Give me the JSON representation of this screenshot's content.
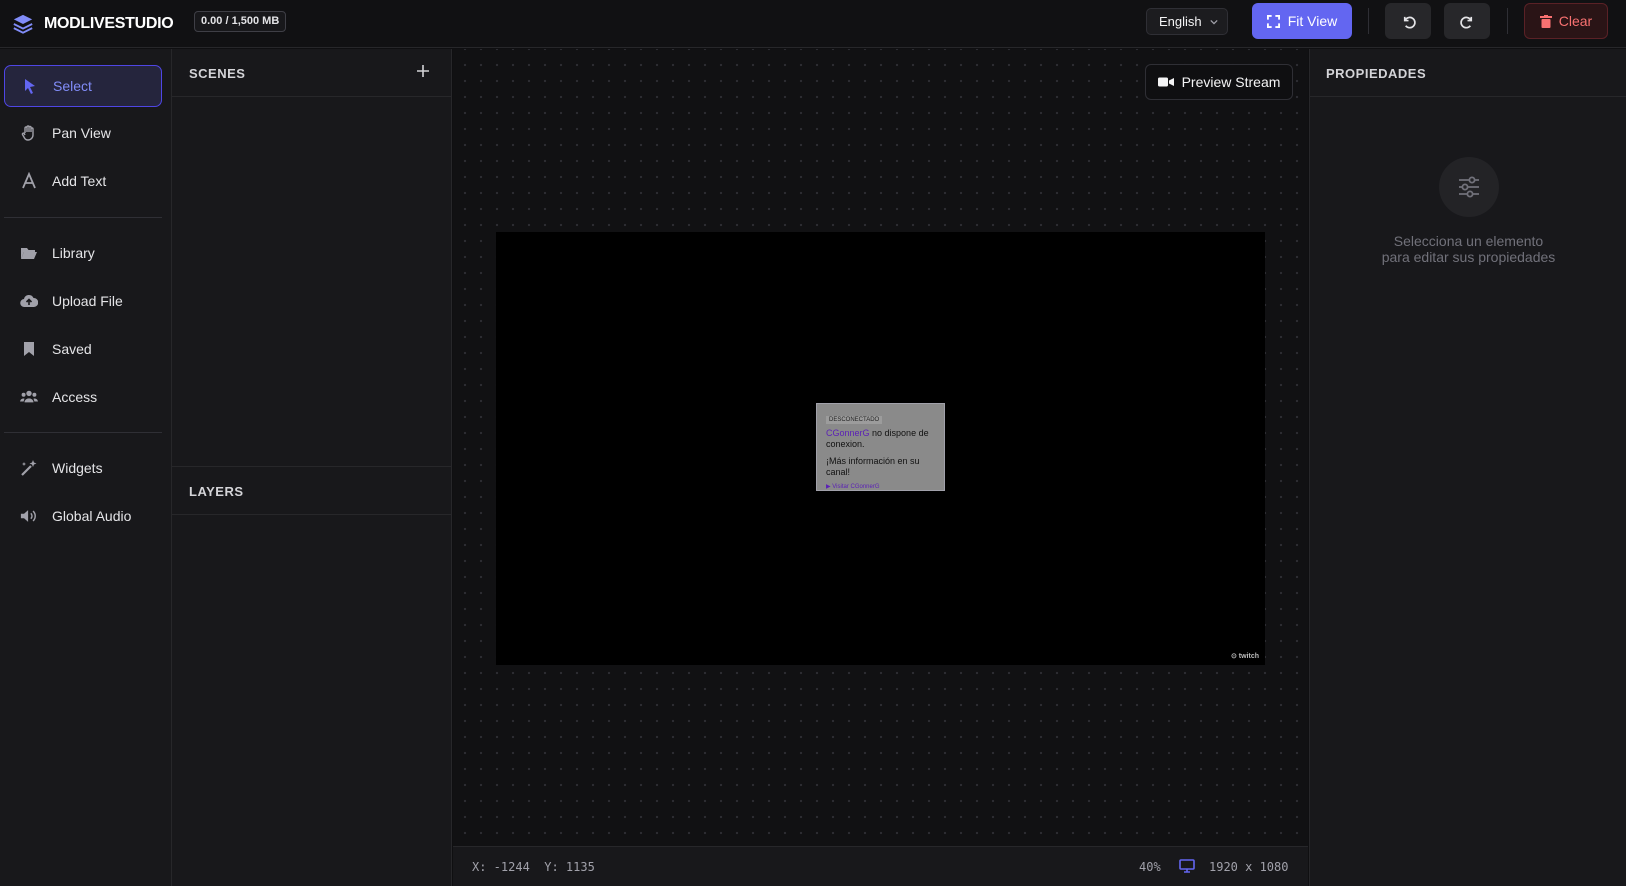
{
  "app": {
    "title": "MODLIVESTUDIO",
    "storage": "0.00 / 1,500 MB"
  },
  "header": {
    "language": "English",
    "fit_view_label": "Fit View",
    "clear_label": "Clear",
    "undo_icon": "undo-icon",
    "redo_icon": "redo-icon"
  },
  "tools": [
    {
      "label": "Select",
      "icon": "cursor-icon",
      "active": true
    },
    {
      "label": "Pan View",
      "icon": "hand-icon"
    },
    {
      "label": "Add Text",
      "icon": "text-icon"
    },
    {
      "label": "Library",
      "icon": "folder-icon"
    },
    {
      "label": "Upload File",
      "icon": "cloud-upload-icon"
    },
    {
      "label": "Saved",
      "icon": "bookmark-icon"
    },
    {
      "label": "Access",
      "icon": "users-icon"
    },
    {
      "label": "Widgets",
      "icon": "magic-wand-icon"
    },
    {
      "label": "Global Audio",
      "icon": "speaker-icon"
    }
  ],
  "scenes": {
    "title": "SCENES",
    "items": []
  },
  "layers": {
    "title": "LAYERS",
    "items": []
  },
  "canvas": {
    "preview_label": "Preview Stream",
    "offline_card": {
      "tag": "DESCONECTADO",
      "channel": "CGonnerG",
      "line1_rest": " no dispone de conexion.",
      "line2": "¡Más información en su canal!",
      "link": "▶ Visitar CGonnerG"
    },
    "watermark": "⊙ twitch"
  },
  "status": {
    "coords": "X: -1244  Y: 1135",
    "zoom": "40%",
    "resolution": "1920 x 1080"
  },
  "properties": {
    "title": "PROPIEDADES",
    "empty_line1": "Selecciona un elemento",
    "empty_line2": "para editar sus propiedades"
  },
  "colors": {
    "accent": "#6366f1",
    "danger": "#f87171",
    "background": "#0f0f11"
  }
}
